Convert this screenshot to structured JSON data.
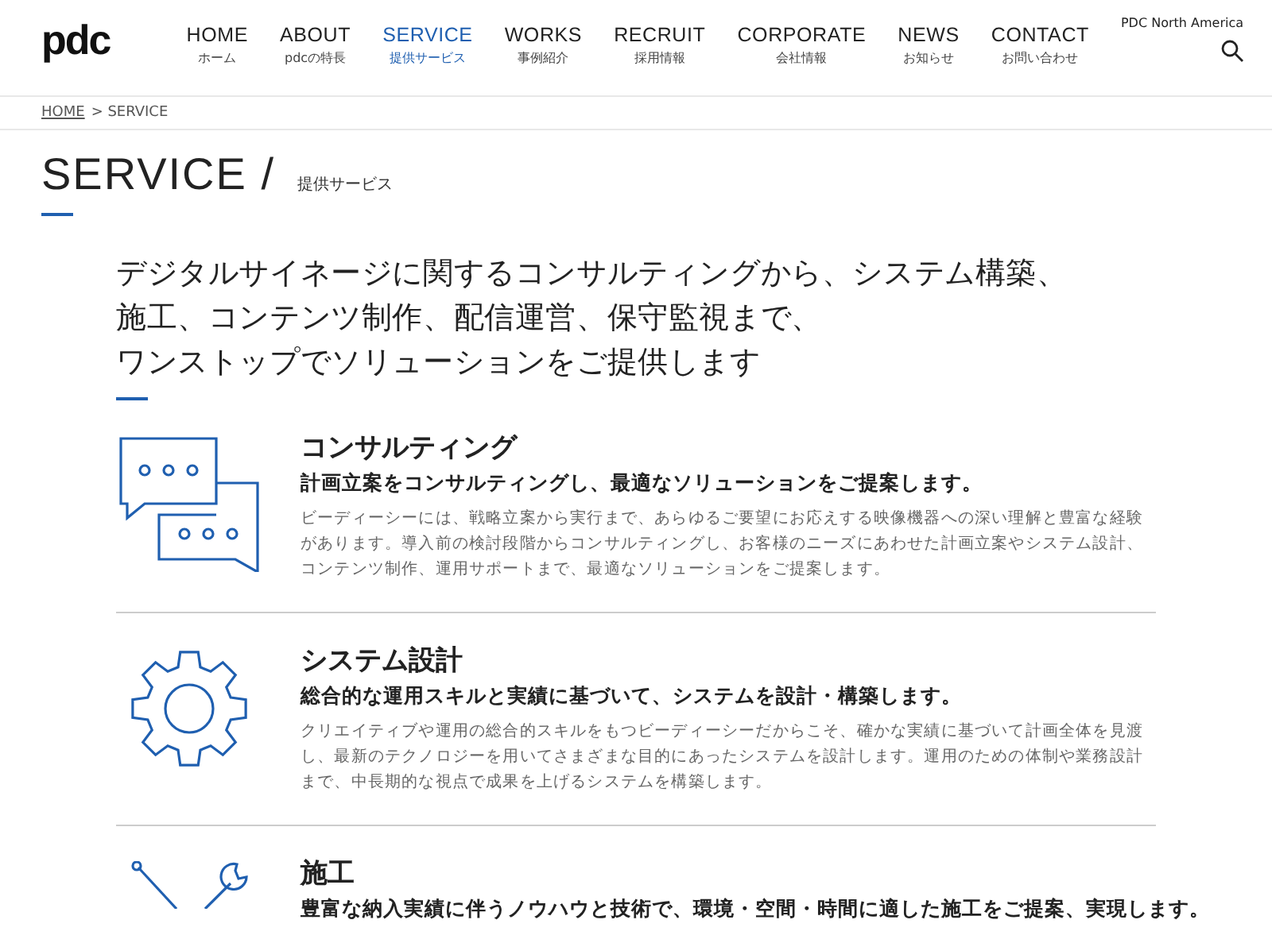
{
  "logo": "pdc",
  "nav": [
    {
      "label": "HOME",
      "sub": "ホーム",
      "selected": false
    },
    {
      "label": "ABOUT",
      "sub": "pdcの特長",
      "selected": false
    },
    {
      "label": "SERVICE",
      "sub": "提供サービス",
      "selected": true
    },
    {
      "label": "WORKS",
      "sub": "事例紹介",
      "selected": false
    },
    {
      "label": "RECRUIT",
      "sub": "採用情報",
      "selected": false
    },
    {
      "label": "CORPORATE",
      "sub": "会社情報",
      "selected": false
    },
    {
      "label": "NEWS",
      "sub": "お知らせ",
      "selected": false
    },
    {
      "label": "CONTACT",
      "sub": "お問い合わせ",
      "selected": false
    }
  ],
  "region_link": "PDC North America",
  "breadcrumb": {
    "home": "HOME",
    "current": "> SERVICE"
  },
  "page_title": {
    "title": "SERVICE /",
    "sub": "提供サービス"
  },
  "intro": [
    "デジタルサイネージに関するコンサルティングから、システム構築、",
    "施工、コンテンツ制作、配信運営、保守監視まで、",
    "ワンストップでソリューションをご提供します"
  ],
  "services": [
    {
      "kind": "chat",
      "title": "コンサルティング",
      "lead": "計画立案をコンサルティングし、最適なソリューションをご提案します。",
      "body": "ビーディーシーには、戦略立案から実行まで、あらゆるご要望にお応えする映像機器への深い理解と豊富な経験があります。導入前の検討段階からコンサルティングし、お客様のニーズにあわせた計画立案やシステム設計、コンテンツ制作、運用サポートまで、最適なソリューションをご提案します。"
    },
    {
      "kind": "gear",
      "title": "システム設計",
      "lead": "総合的な運用スキルと実績に基づいて、システムを設計・構築します。",
      "body": "クリエイティブや運用の総合的スキルをもつビーディーシーだからこそ、確かな実績に基づいて計画全体を見渡し、最新のテクノロジーを用いてさまざまな目的にあったシステムを設計します。運用のための体制や業務設計まで、中長期的な視点で成果を上げるシステムを構築します。"
    },
    {
      "kind": "tools",
      "title": "施工",
      "lead": "豊富な納入実績に伴うノウハウと技術で、環境・空間・時間に適した施工をご提案、実現します。"
    }
  ]
}
